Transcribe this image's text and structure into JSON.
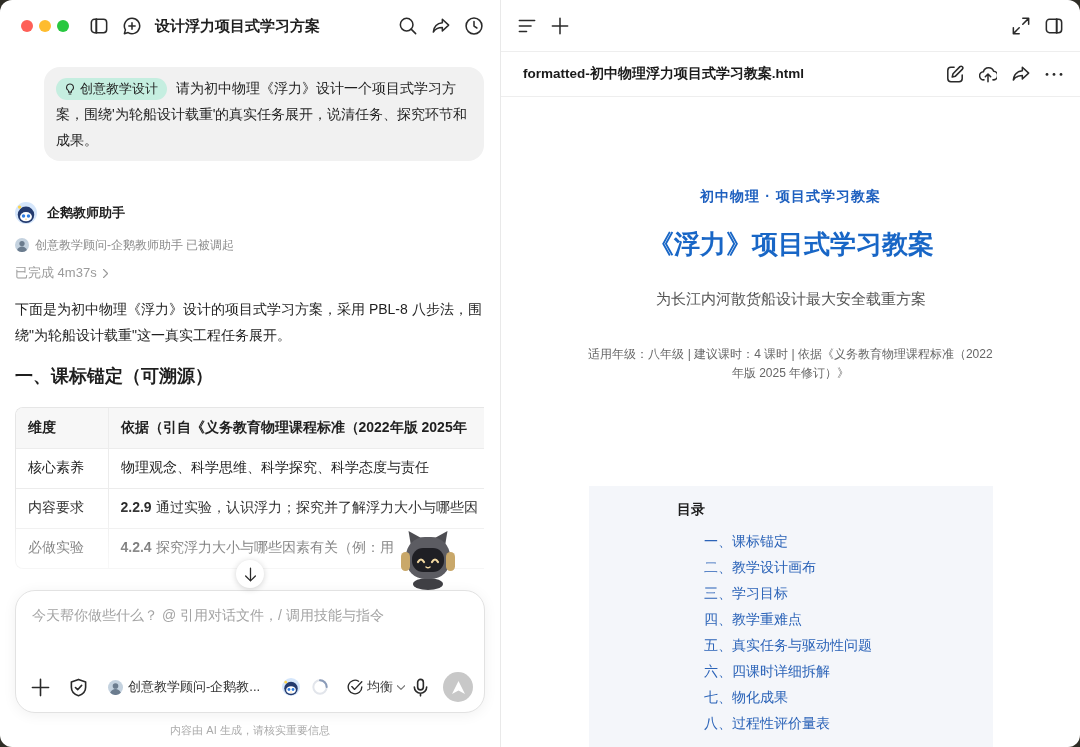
{
  "window": {
    "title": "设计浮力项目式学习方案"
  },
  "chat": {
    "user_message": {
      "skill": "创意教学设计",
      "text": "请为初中物理《浮力》设计一个项目式学习方案，围绕'为轮船设计载重'的真实任务展开，说清任务、探究环节和成果。"
    },
    "reply": {
      "assistant": "企鹅教师助手",
      "invocation": "创意教学顾问-企鹅教师助手 已被调起",
      "status": "已完成 4m37s",
      "intro": "下面是为初中物理《浮力》设计的项目式学习方案，采用 PBL-8 八步法，围绕\"为轮船设计载重\"这一真实工程任务展开。",
      "heading": "一、课标锚定（可溯源）",
      "table": {
        "columns": [
          "维度",
          "依据（引自《义务教育物理课程标准（2022年版 2025年"
        ],
        "rows": [
          [
            "核心素养",
            "物理观念、科学思维、科学探究、科学态度与责任"
          ],
          [
            "内容要求",
            "**2.2.9** 通过实验，认识浮力；探究并了解浮力大小与哪些因"
          ],
          [
            "必做实验",
            "**4.2.4** 探究浮力大小与哪些因素有关（例：用"
          ]
        ]
      }
    }
  },
  "composer": {
    "placeholder": "今天帮你做些什么？ @ 引用对话文件，/ 调用技能与指令",
    "agent": "创意教学顾问-企鹅教...",
    "mode": "均衡",
    "send_button": {
      "disabled": true
    },
    "disclaimer": "内容由 AI 生成，请核实重要信息"
  },
  "preview": {
    "filename": "formatted-初中物理浮力项目式学习教案.html",
    "document": {
      "kicker": "初中物理 · 项目式学习教案",
      "title": "《浮力》项目式学习教案",
      "subtitle": "为长江内河散货船设计最大安全载重方案",
      "meta": "适用年级：八年级 | 建议课时：4 课时 | 依据《义务教育物理课程标准（2022 年版 2025 年修订）》",
      "toc": {
        "title": "目录",
        "items": [
          "一、课标锚定",
          "二、教学设计画布",
          "三、学习目标",
          "四、教学重难点",
          "五、真实任务与驱动性问题",
          "六、四课时详细拆解",
          "七、物化成果",
          "八、过程性评价量表"
        ]
      }
    }
  }
}
